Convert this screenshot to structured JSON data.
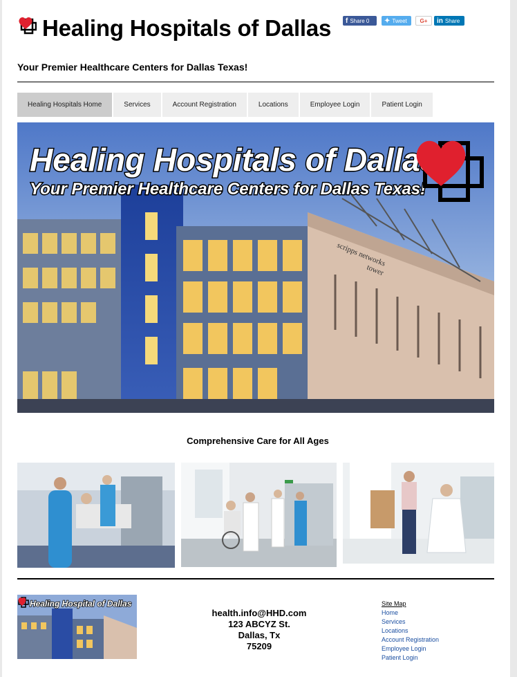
{
  "header": {
    "title": "Healing Hospitals of Dallas",
    "tagline": "Your Premier Healthcare Centers for Dallas Texas!"
  },
  "share": {
    "facebook": "Share 0",
    "twitter": "Tweet",
    "google": "G+",
    "linkedin": "Share"
  },
  "nav": {
    "items": [
      "Healing Hospitals Home",
      "Services",
      "Account Registration",
      "Locations",
      "Employee Login",
      "Patient Login"
    ]
  },
  "hero": {
    "title": "Healing Hospitals of Dallas",
    "subtitle": "Your Premier Healthcare Centers for Dallas Texas!",
    "building_sign_1": "scripps networks",
    "building_sign_2": "tower"
  },
  "main": {
    "section_title": "Comprehensive Care for All Ages"
  },
  "footer": {
    "logo_text": "Healing Hospital of Dallas",
    "email": "health.info@HHD.com",
    "address": "123 ABCYZ St.",
    "city": "Dallas, Tx",
    "zip": "75209",
    "sitemap_title": "Site Map",
    "sitemap_links": [
      "Home",
      "Services",
      "Locations",
      "Account Registration",
      "Employee Login",
      "Patient Login"
    ]
  },
  "colors": {
    "brand_red": "#e0202e",
    "nav_bg": "#eeeeee",
    "nav_active_bg": "#cccccc",
    "link_blue": "#1a4ea0"
  }
}
